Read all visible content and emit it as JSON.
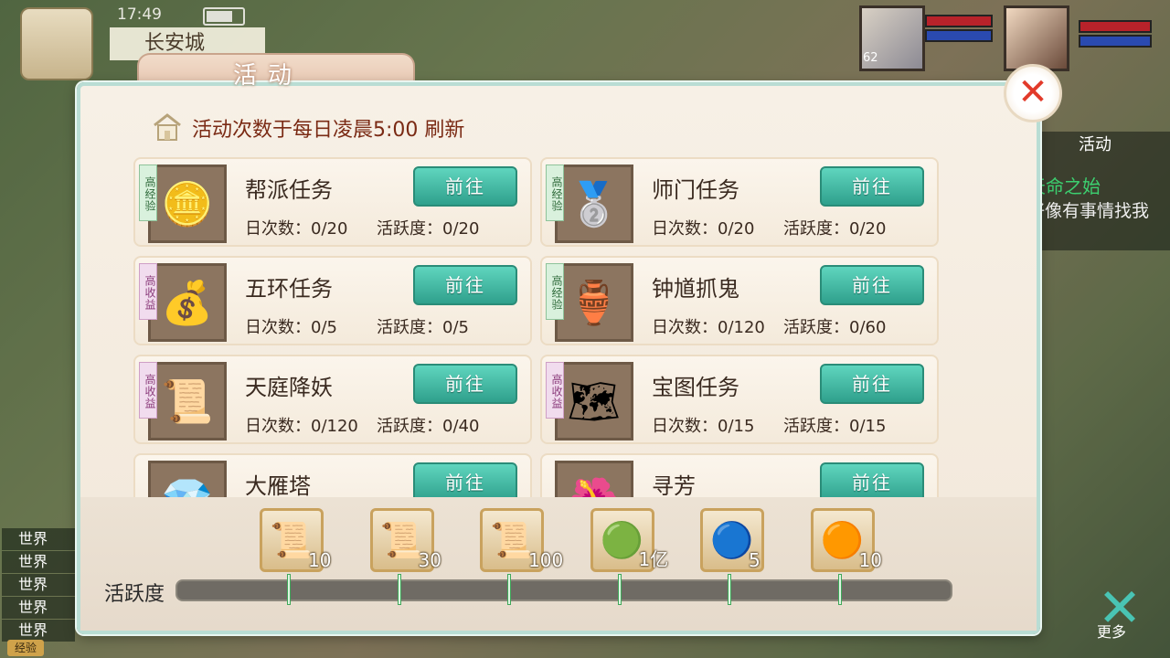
{
  "hud": {
    "time": "17:49",
    "city": "长安城",
    "player_level": "62",
    "right_tab": "活动",
    "quest_title": "天命之始",
    "quest_desc": "好像有事情找我",
    "chat_channel": "世界",
    "exp_label": "经验",
    "more_label": "更多"
  },
  "dialog": {
    "title": "活动",
    "notice": "活动次数于每日凌晨5:00 刷新",
    "close_icon": "close-icon"
  },
  "activities": [
    {
      "name": "帮派任务",
      "tag": "高经验",
      "tag_type": "exp",
      "count": "日次数：0/20",
      "active": "活跃度：0/20",
      "button": "前往",
      "icon": "coin-icon",
      "glyph": "🪙"
    },
    {
      "name": "师门任务",
      "tag": "高经验",
      "tag_type": "exp",
      "count": "日次数：0/20",
      "active": "活跃度：0/20",
      "button": "前往",
      "icon": "silver-coin-icon",
      "glyph": "🥈"
    },
    {
      "name": "五环任务",
      "tag": "高收益",
      "tag_type": "inc",
      "count": "日次数：0/5",
      "active": "活跃度：0/5",
      "button": "前往",
      "icon": "silver-ingot-icon",
      "glyph": "💰"
    },
    {
      "name": "钟馗抓鬼",
      "tag": "高经验",
      "tag_type": "exp",
      "count": "日次数：0/120",
      "active": "活跃度：0/60",
      "button": "前往",
      "icon": "vase-icon",
      "glyph": "🏺"
    },
    {
      "name": "天庭降妖",
      "tag": "高收益",
      "tag_type": "inc",
      "count": "日次数：0/120",
      "active": "活跃度：0/40",
      "button": "前往",
      "icon": "scroll-icon",
      "glyph": "📜"
    },
    {
      "name": "宝图任务",
      "tag": "高收益",
      "tag_type": "inc",
      "count": "日次数：0/15",
      "active": "活跃度：0/15",
      "button": "前往",
      "icon": "treasure-map-icon",
      "glyph": "🗺"
    },
    {
      "name": "大雁塔",
      "tag": "",
      "tag_type": "",
      "count": "",
      "active": "",
      "button": "前往",
      "icon": "dark-gem-icon",
      "glyph": "💎"
    },
    {
      "name": "寻芳",
      "tag": "",
      "tag_type": "",
      "count": "",
      "active": "",
      "button": "前往",
      "icon": "red-flower-icon",
      "glyph": "🌺"
    }
  ],
  "activity_bar": {
    "label": "活跃度",
    "progress": 0,
    "rewards": [
      {
        "value": "10",
        "icon": "scroll-reward-icon",
        "glyph": "📜"
      },
      {
        "value": "30",
        "icon": "scroll-reward-icon",
        "glyph": "📜"
      },
      {
        "value": "100",
        "icon": "scroll-reward-icon",
        "glyph": "📜"
      },
      {
        "value": "1亿",
        "icon": "jade-icon",
        "glyph": "🟢"
      },
      {
        "value": "5",
        "icon": "blue-orb-icon",
        "glyph": "🔵"
      },
      {
        "value": "10",
        "icon": "treasure-chest-icon",
        "glyph": "🟠"
      }
    ]
  },
  "colors": {
    "button": "#3fb8a0",
    "exp_tag": "#d9f1dd",
    "income_tag": "#f1dcee",
    "close": "#e23a2a"
  }
}
